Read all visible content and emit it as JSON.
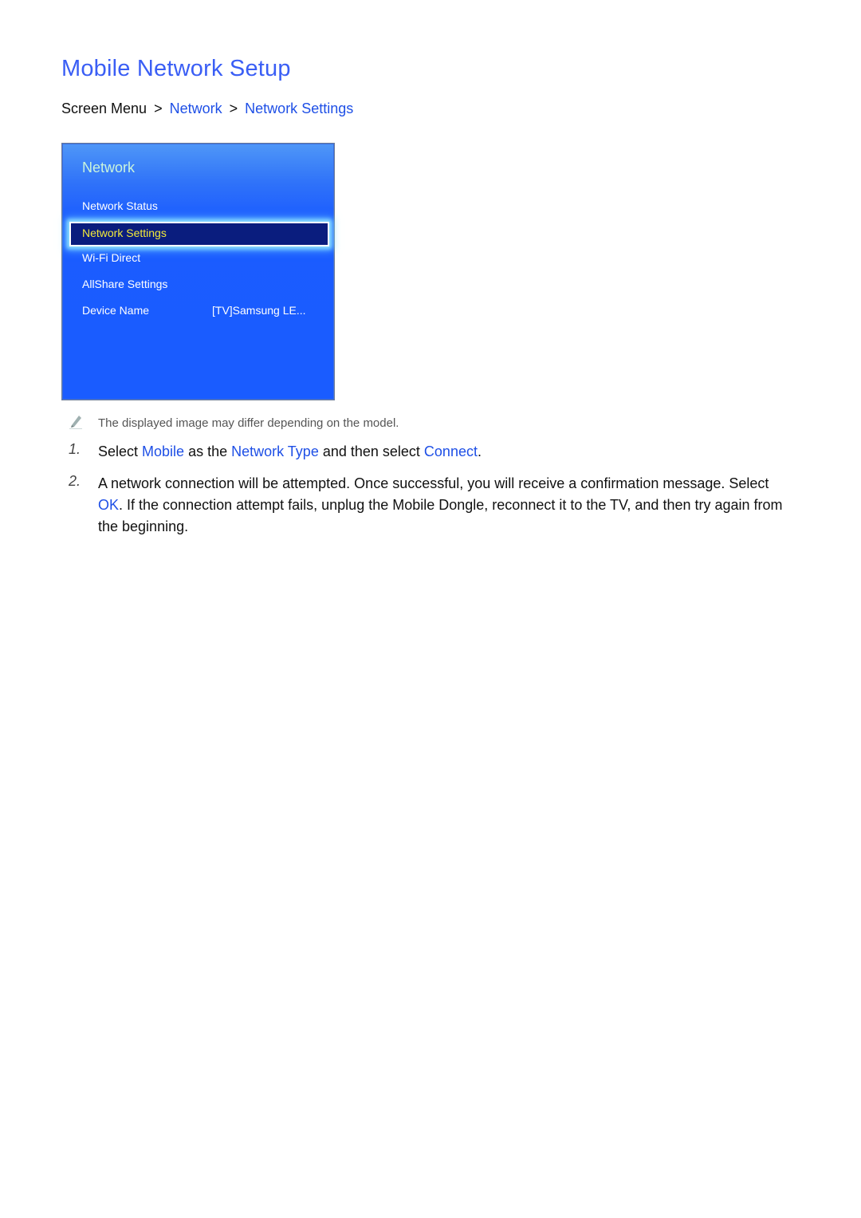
{
  "page": {
    "title": "Mobile Network Setup",
    "breadcrumb": {
      "root": "Screen Menu",
      "separator": ">",
      "items": [
        "Network",
        "Network Settings"
      ]
    }
  },
  "tv_menu": {
    "title": "Network",
    "items": [
      {
        "label": "Network Status"
      },
      {
        "label": "Network Settings",
        "selected": true
      },
      {
        "label": "Wi-Fi Direct"
      },
      {
        "label": "AllShare Settings"
      },
      {
        "label": "Device Name",
        "value": "[TV]Samsung LE..."
      }
    ],
    "colors": {
      "background": "#1a5cff",
      "selected_bg": "#0a1d7e",
      "selected_text": "#f3ea3a",
      "title": "#c9f4dc"
    }
  },
  "note": {
    "icon": "pencil-icon",
    "text": "The displayed image may differ depending on the model."
  },
  "steps": [
    {
      "number": "1.",
      "parts": [
        {
          "t": "Select "
        },
        {
          "t": "Mobile",
          "hl": true
        },
        {
          "t": " as the "
        },
        {
          "t": "Network Type",
          "hl": true
        },
        {
          "t": " and then select "
        },
        {
          "t": "Connect",
          "hl": true
        },
        {
          "t": "."
        }
      ]
    },
    {
      "number": "2.",
      "parts": [
        {
          "t": "A network connection will be attempted. Once successful, you will receive a confirmation message. Select "
        },
        {
          "t": "OK",
          "hl": true
        },
        {
          "t": ". If the connection attempt fails, unplug the Mobile Dongle, reconnect it to the TV, and then try again from the beginning."
        }
      ]
    }
  ],
  "colors": {
    "accent": "#1e4fe6",
    "title": "#3a5ef5"
  }
}
